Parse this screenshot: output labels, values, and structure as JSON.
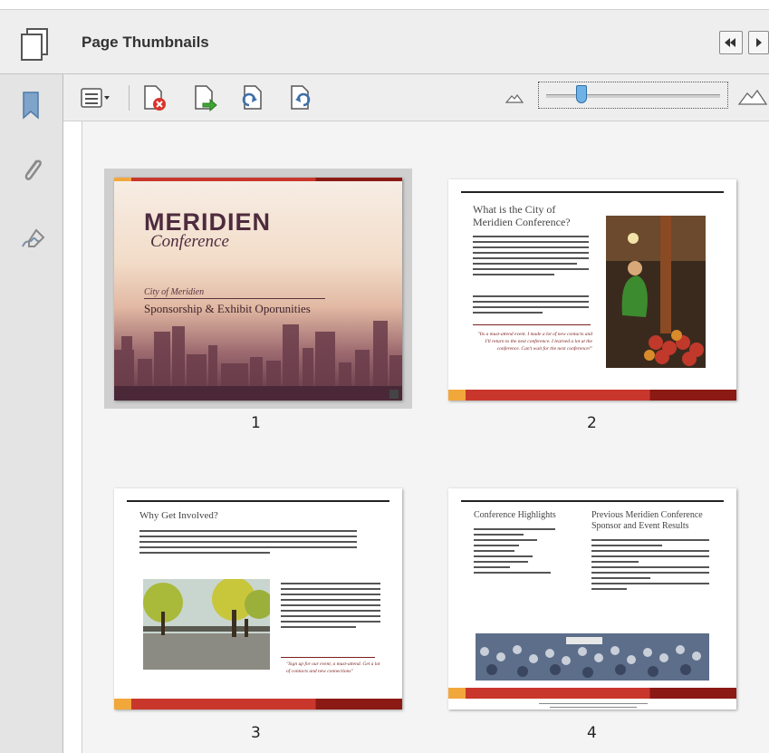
{
  "panel": {
    "title": "Page Thumbnails"
  },
  "colors": {
    "accent_red": "#c9372c",
    "accent_orange": "#f2a73b"
  },
  "toolbar": {
    "icons": [
      "options-menu-icon",
      "delete-pages-icon",
      "insert-pages-icon",
      "undo-icon",
      "redo-icon"
    ],
    "zoom_min_icon": "mountain-small-icon",
    "zoom_max_icon": "mountain-large-icon",
    "zoom_level": 0.18
  },
  "sidebar": {
    "icons": [
      "bookmark-icon",
      "attachment-icon",
      "signature-icon"
    ]
  },
  "thumbnails": [
    {
      "number": "1",
      "selected": true,
      "brand": "MERIDIEN",
      "brand_sub": "Conference",
      "kicker": "City of Meridien",
      "subtitle": "Sponsorship & Exhibit Oporunities"
    },
    {
      "number": "2",
      "heading": "What is the City of Meridien Conference?",
      "quote": "\"Its a must-attend event. I made a lot of new contacts and I'll return to the next conference. I learned a lot at the conference. Can't wait for the next conference!\""
    },
    {
      "number": "3",
      "heading": "Why Get Involved?",
      "quote": "\"Sign up for our event, a must-attend. Get a lot of contacts and new connections\""
    },
    {
      "number": "4",
      "heading_left": "Conference Highlights",
      "heading_right": "Previous Meridien Conference Sponsor and Event Results"
    }
  ]
}
